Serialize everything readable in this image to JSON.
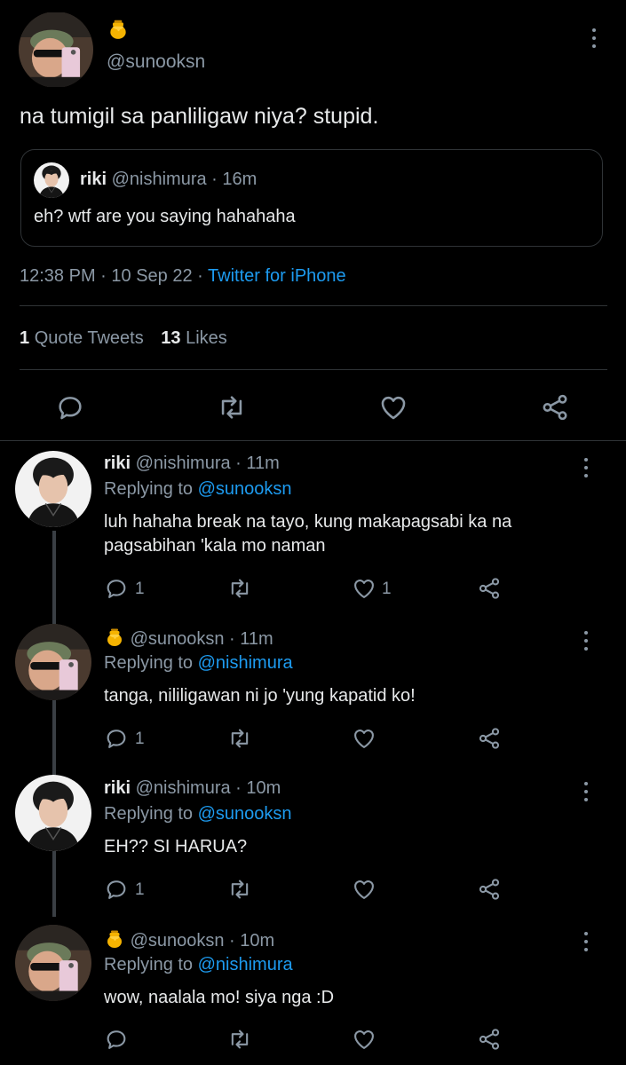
{
  "main_tweet": {
    "emoji": "🍯",
    "handle": "@sunooksn",
    "text": "na tumigil sa panliligaw niya? stupid.",
    "quoted": {
      "name": "riki",
      "handle": "@nishimura",
      "sep": "·",
      "time": "16m",
      "text": "eh? wtf are you saying hahahaha"
    },
    "meta": {
      "time": "12:38 PM",
      "sep1": "·",
      "date": "10 Sep 22",
      "sep2": "·",
      "source": "Twitter for iPhone"
    },
    "stats": {
      "quote_count": "1",
      "quote_label": "Quote Tweets",
      "like_count": "13",
      "like_label": "Likes"
    }
  },
  "replies": [
    {
      "name": "riki",
      "handle": "@nishimura",
      "sep": "·",
      "time": "11m",
      "replying_label": "Replying to",
      "replying_to": "@sunooksn",
      "text_line1": "luh hahaha break na tayo, kung makapagsabi ka na",
      "text_line2": "pagsabihan 'kala mo naman",
      "reply_count": "1",
      "like_count": "1"
    },
    {
      "emoji": "🍯",
      "handle": "@sunooksn",
      "sep": "·",
      "time": "11m",
      "replying_label": "Replying to",
      "replying_to": "@nishimura",
      "text_line1": "tanga, nililigawan ni jo 'yung kapatid ko!",
      "reply_count": "1"
    },
    {
      "name": "riki",
      "handle": "@nishimura",
      "sep": "·",
      "time": "10m",
      "replying_label": "Replying to",
      "replying_to": "@sunooksn",
      "text_line1": "EH?? SI HARUA?",
      "reply_count": "1"
    },
    {
      "emoji": "🍯",
      "handle": "@sunooksn",
      "sep": "·",
      "time": "10m",
      "replying_label": "Replying to",
      "replying_to": "@nishimura",
      "text_line1": "wow, naalala mo! siya nga :D"
    }
  ],
  "icons": {
    "reply": "reply-icon",
    "retweet": "retweet-icon",
    "like": "heart-icon",
    "share": "share-icon",
    "more": "more-icon",
    "honey": "honey-pot-icon"
  },
  "colors": {
    "background": "#000000",
    "text": "#e7e9ea",
    "muted": "#8b98a5",
    "link": "#1d9bf0",
    "border": "#2f3336"
  }
}
